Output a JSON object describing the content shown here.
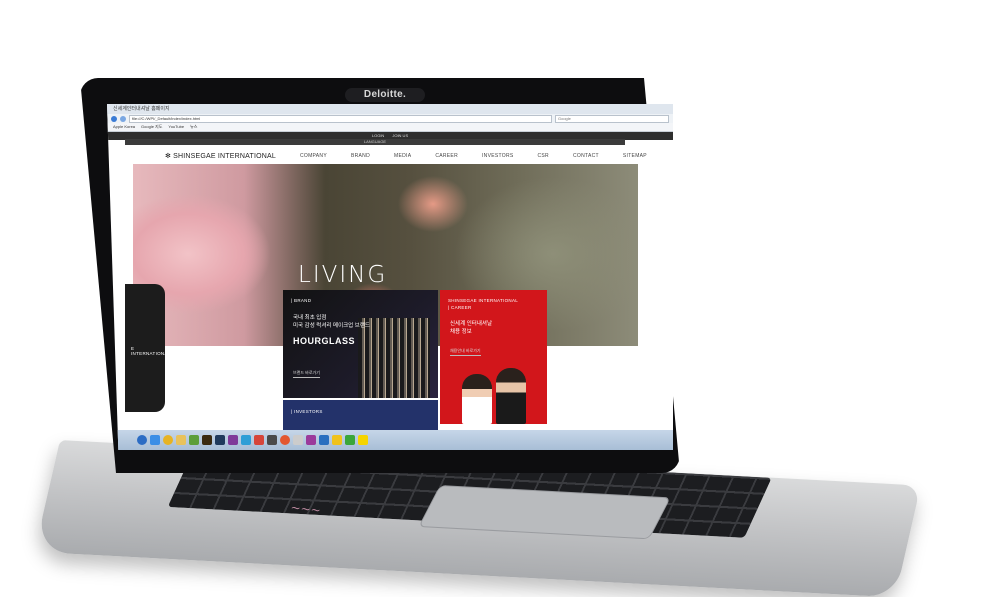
{
  "bezel": {
    "camera_label": "Deloitte."
  },
  "browser": {
    "window_title": "신세계인터내셔날 홈페이지",
    "url": "file:///C:/WPI/_Default/index/index.html",
    "search_placeholder": "Google",
    "bookmarks": [
      "Apple Korea",
      "Google 지도",
      "YouTube",
      "뉴스"
    ]
  },
  "site": {
    "top_links": [
      "LOGIN",
      "JOIN US"
    ],
    "lang_bar": "LANGUAGE",
    "logo": "SHINSEGAE INTERNATIONAL",
    "nav": [
      "COMPANY",
      "BRAND",
      "MEDIA",
      "CAREER",
      "INVESTORS",
      "CSR",
      "CONTACT",
      "SITEMAP"
    ],
    "hero_title": "LIVING",
    "side_tab": "E INTERNATIONAL",
    "brand_card": {
      "label": "| BRAND",
      "text1": "국내 최초 입점",
      "text2": "미국 감성 럭셔리 메이크업 브랜드",
      "name": "HOURGLASS",
      "link": "브랜드 바로가기"
    },
    "career_card": {
      "label1": "SHINSEGAE INTERNATIONAL",
      "label2": "| CAREER",
      "text1": "신세계 인터내셔날",
      "text2": "채용 정보",
      "link": "채용안내 바로가기"
    },
    "investors_card": {
      "label": "| INVESTORS"
    }
  },
  "sticker": "~~~"
}
